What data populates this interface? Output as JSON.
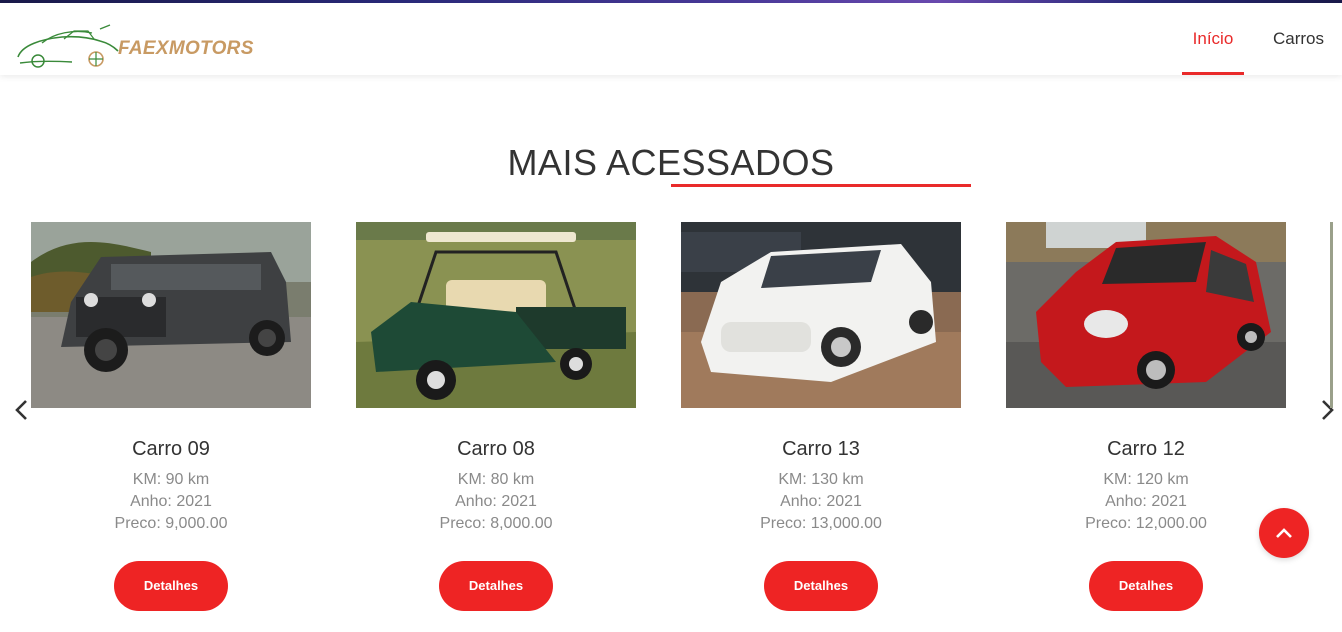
{
  "brand": {
    "name": "FAEXMOTORS",
    "logo_icon": "car-logo-icon",
    "color": "#c89a63"
  },
  "nav": {
    "items": [
      {
        "label": "Início",
        "active": true
      },
      {
        "label": "Carros",
        "active": false
      }
    ]
  },
  "section": {
    "title": "MAIS ACESSADOS"
  },
  "colors": {
    "accent": "#e92a2a",
    "text": "#333333",
    "muted": "#8a8a8a"
  },
  "cars": [
    {
      "title": "Carro 09",
      "km": "KM: 90 km",
      "year": "Anho: 2021",
      "price": "Preco: 9,000.00",
      "button": "Detalhes",
      "photo": "gray-jeep-suv"
    },
    {
      "title": "Carro 08",
      "km": "KM: 80 km",
      "year": "Anho: 2021",
      "price": "Preco: 8,000.00",
      "button": "Detalhes",
      "photo": "green-golf-cart"
    },
    {
      "title": "Carro 13",
      "km": "KM: 130 km",
      "year": "Anho: 2021",
      "price": "Preco: 13,000.00",
      "button": "Detalhes",
      "photo": "white-sedan"
    },
    {
      "title": "Carro 12",
      "km": "KM: 120 km",
      "year": "Anho: 2021",
      "price": "Preco: 12,000.00",
      "button": "Detalhes",
      "photo": "red-hatchback"
    }
  ],
  "controls": {
    "prev_icon": "chevron-left-icon",
    "next_icon": "chevron-right-icon",
    "to_top_icon": "chevron-up-icon"
  }
}
